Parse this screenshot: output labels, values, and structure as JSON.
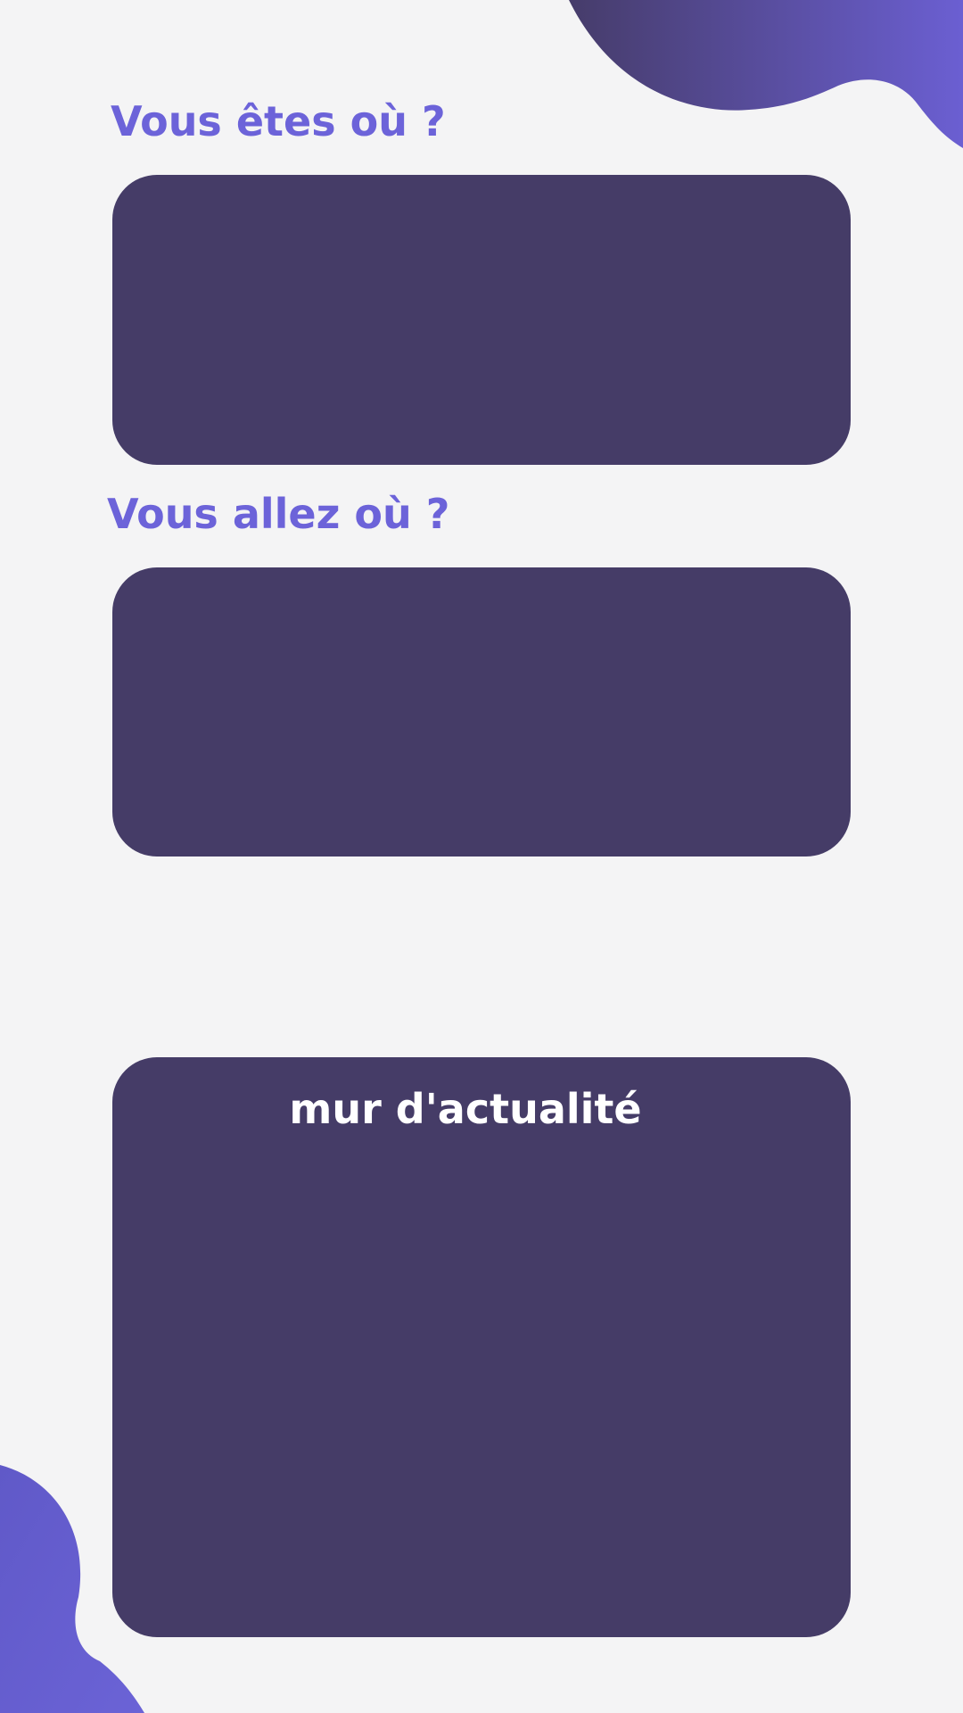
{
  "colors": {
    "background": "#f4f4f5",
    "accent": "#6c63d9",
    "card": "#453c67",
    "card_text": "#ffffff",
    "blob_gradient_start": "#463c6a",
    "blob_gradient_end": "#6b63d6"
  },
  "departure": {
    "title": "Vous êtes où ?"
  },
  "destination": {
    "title": "Vous allez où ?"
  },
  "news_wall": {
    "title": "mur d'actualité"
  }
}
